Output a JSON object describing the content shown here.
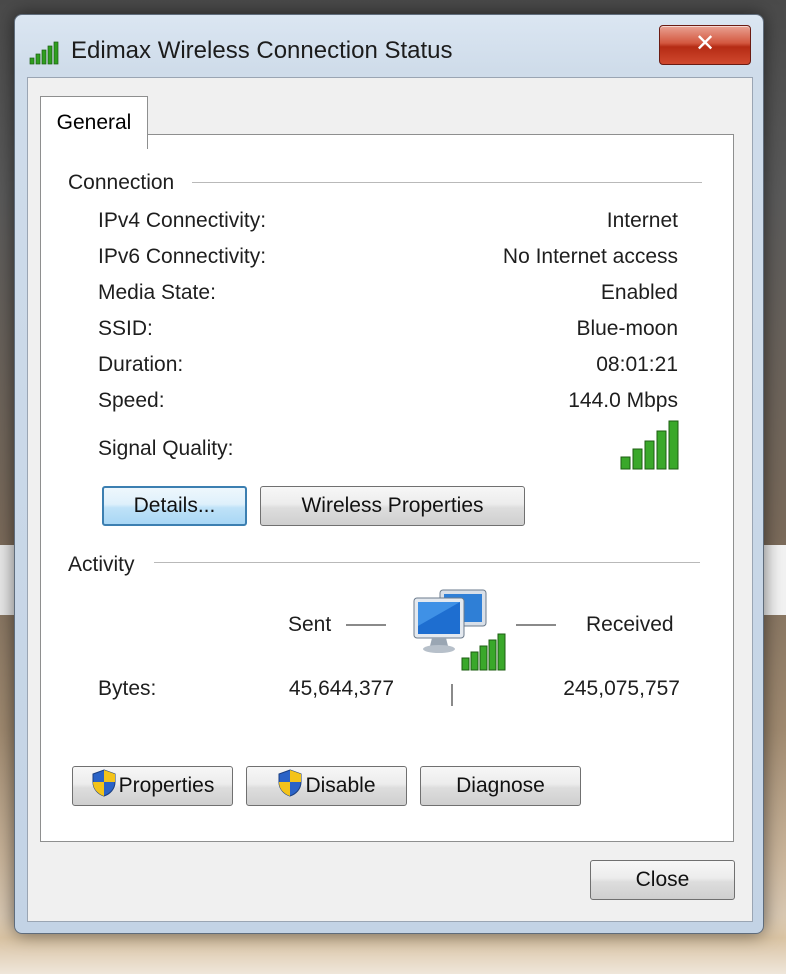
{
  "window": {
    "title": "Edimax Wireless Connection Status",
    "close_glyph": "✕"
  },
  "tabs": [
    {
      "label": "General",
      "active": true
    }
  ],
  "connection": {
    "heading": "Connection",
    "rows": [
      {
        "label": "IPv4 Connectivity:",
        "value": "Internet"
      },
      {
        "label": "IPv6 Connectivity:",
        "value": "No Internet access"
      },
      {
        "label": "Media State:",
        "value": "Enabled"
      },
      {
        "label": "SSID:",
        "value": "Blue-moon"
      },
      {
        "label": "Duration:",
        "value": "08:01:21"
      },
      {
        "label": "Speed:",
        "value": "144.0 Mbps"
      }
    ],
    "signal_label": "Signal Quality:",
    "signal_bars_lit": 5,
    "signal_bars_total": 5,
    "details_button": "Details...",
    "wireless_properties_button": "Wireless Properties"
  },
  "activity": {
    "heading": "Activity",
    "sent_label": "Sent",
    "received_label": "Received",
    "bytes_label": "Bytes:",
    "bytes_sent": "45,644,377",
    "bytes_received": "245,075,757"
  },
  "buttons": {
    "properties": "Properties",
    "disable": "Disable",
    "diagnose": "Diagnose",
    "close": "Close"
  },
  "colors": {
    "signal_green": "#2f9e1f",
    "default_button_border": "#3c7fb1",
    "close_red": "#c43a22"
  },
  "icons": {
    "title": "signal-bars-icon",
    "network": "network-computers-icon",
    "uac": "uac-shield-icon"
  }
}
